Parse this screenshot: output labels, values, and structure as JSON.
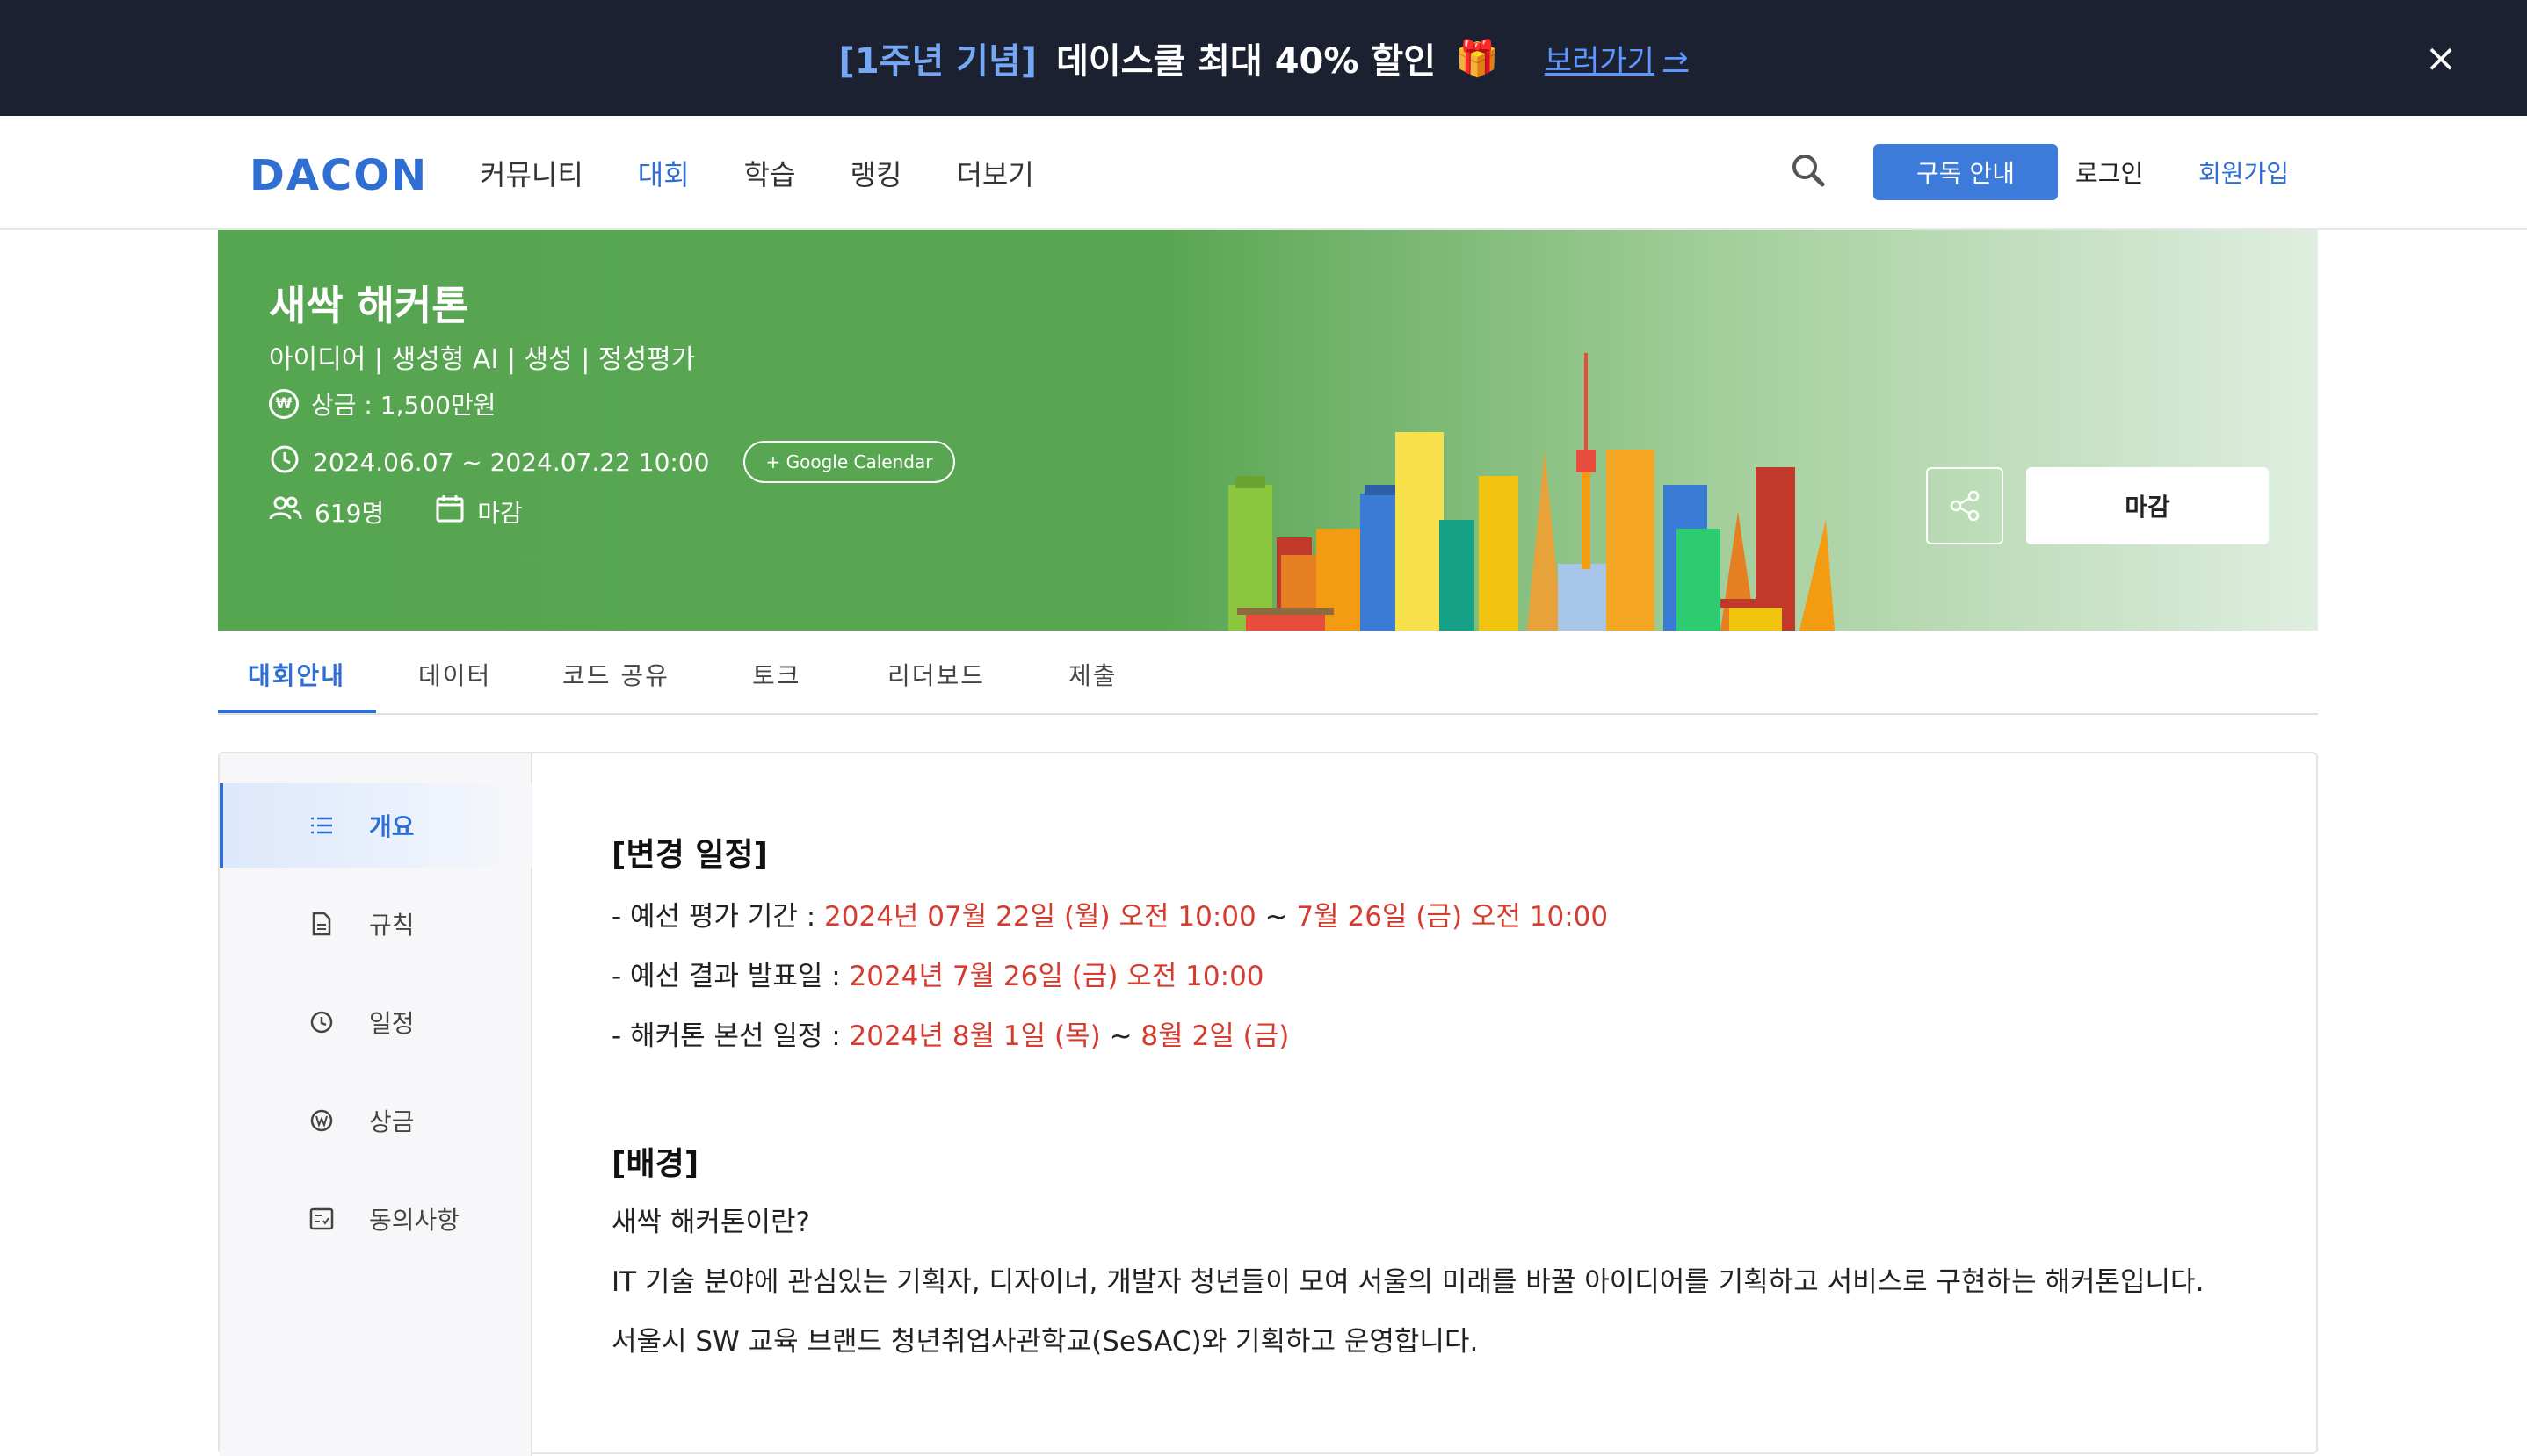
{
  "promo": {
    "tag": "[1주년 기념]",
    "text": "데이스쿨 최대 40% 할인",
    "gift": "🎁",
    "link": "보러가기",
    "arrow": "→",
    "close": "×"
  },
  "nav": {
    "logo": "DACON",
    "menu": [
      "커뮤니티",
      "대회",
      "학습",
      "랭킹",
      "더보기"
    ],
    "active_index": 1,
    "subscribe": "구독 안내",
    "login": "로그인",
    "signup": "회원가입"
  },
  "hero": {
    "title": "새싹 해커톤",
    "tags": "아이디어 | 생성형 AI | 생성 | 정성평가",
    "prize_symbol": "₩",
    "prize": "상금 : 1,500만원",
    "period": "2024.06.07 ~ 2024.07.22 10:00",
    "google_calendar": "+ Google Calendar",
    "participants": "619명",
    "status": "마감",
    "close_button": "마감"
  },
  "tabs": [
    "대회안내",
    "데이터",
    "코드 공유",
    "토크",
    "리더보드",
    "제출"
  ],
  "sidebar": [
    "개요",
    "규칙",
    "일정",
    "상금",
    "동의사항"
  ],
  "content": {
    "schedule_heading": "[변경 일정]",
    "prelim_label": "- 예선 평가 기간 : ",
    "prelim_start": "2024년 07월 22일 (월) 오전 10:00",
    "tilde1": " ~ ",
    "prelim_end": "7월 26일 (금) 오전 10:00",
    "result_label": "- 예선 결과 발표일 : ",
    "result_date": "2024년 7월 26일 (금) 오전 10:00",
    "final_label": "- 해커톤 본선 일정 : ",
    "final_start": "2024년 8월 1일 (목)",
    "tilde2": " ~ ",
    "final_end": "8월 2일 (금)",
    "background_heading": "[배경]",
    "bg_line1": "새싹 해커톤이란?",
    "bg_line2": "IT 기술 분야에 관심있는 기획자, 디자이너, 개발자 청년들이 모여 서울의 미래를 바꿀 아이디어를 기획하고 서비스로 구현하는 해커톤입니다.",
    "bg_line3": "서울시 SW 교육 브랜드 청년취업사관학교(SeSAC)와 기획하고 운영합니다."
  },
  "colors": {
    "accent": "#2f6fd4",
    "promo_bg": "#1b2130",
    "hero_green": "#56a550",
    "highlight_red": "#d63b2e"
  }
}
